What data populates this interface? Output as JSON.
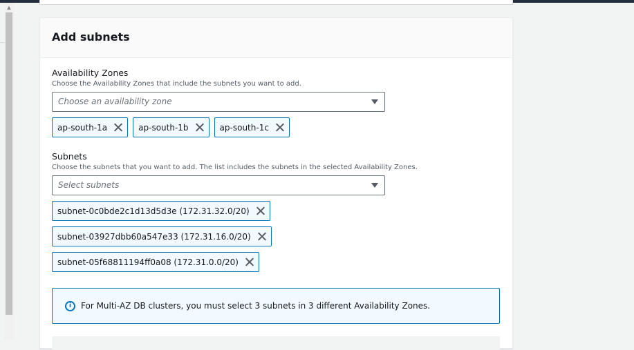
{
  "panel": {
    "title": "Add subnets"
  },
  "availability_zones": {
    "label": "Availability Zones",
    "description": "Choose the Availability Zones that include the subnets you want to add.",
    "placeholder": "Choose an availability zone",
    "selected": [
      "ap-south-1a",
      "ap-south-1b",
      "ap-south-1c"
    ]
  },
  "subnets": {
    "label": "Subnets",
    "description": "Choose the subnets that you want to add. The list includes the subnets in the selected Availability Zones.",
    "placeholder": "Select subnets",
    "selected": [
      "subnet-0c0bde2c1d13d5d3e (172.31.32.0/20)",
      "subnet-03927dbb60a547e33 (172.31.16.0/20)",
      "subnet-05f68811194ff0a08 (172.31.0.0/20)"
    ]
  },
  "info": {
    "icon": "info-icon",
    "text": "For Multi-AZ DB clusters, you must select 3 subnets in 3 different Availability Zones."
  },
  "colors": {
    "accent": "#0073bb",
    "token_bg": "#f1faff",
    "header_bar": "#232f3e"
  }
}
